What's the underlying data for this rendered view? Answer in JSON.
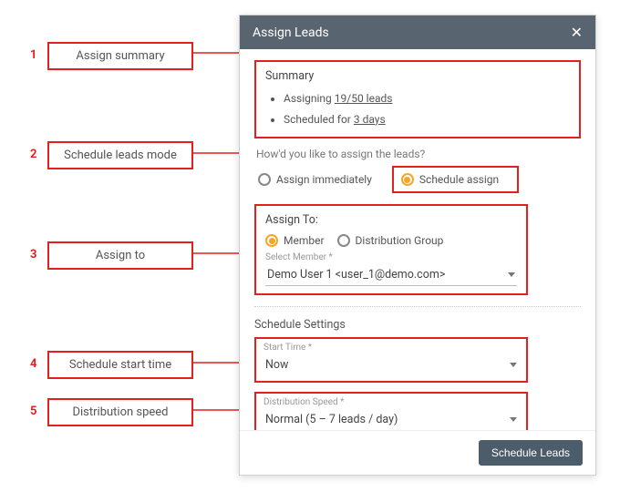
{
  "callouts": {
    "n1": "1",
    "l1": "Assign summary",
    "n2": "2",
    "l2": "Schedule leads mode",
    "n3": "3",
    "l3": "Assign to",
    "n4": "4",
    "l4": "Schedule start time",
    "n5": "5",
    "l5": "Distribution speed"
  },
  "panel": {
    "title": "Assign Leads",
    "summary": {
      "heading": "Summary",
      "line1_a": "Assigning ",
      "line1_u": "19/50 leads",
      "line2_a": "Scheduled for ",
      "line2_u": "3 days"
    },
    "question": "How'd you like to assign the leads?",
    "mode": {
      "opt1": "Assign immediately",
      "opt2": "Schedule assign"
    },
    "assign_to": {
      "heading": "Assign To:",
      "opt_member": "Member",
      "opt_group": "Distribution Group",
      "select_label": "Select Member *",
      "select_value": "Demo User 1 <user_1@demo.com>"
    },
    "schedule": {
      "heading": "Schedule Settings",
      "start_label": "Start Time *",
      "start_value": "Now",
      "speed_label": "Distribution Speed *",
      "speed_value": "Normal (5 – 7 leads / day)"
    },
    "submit": "Schedule Leads"
  }
}
